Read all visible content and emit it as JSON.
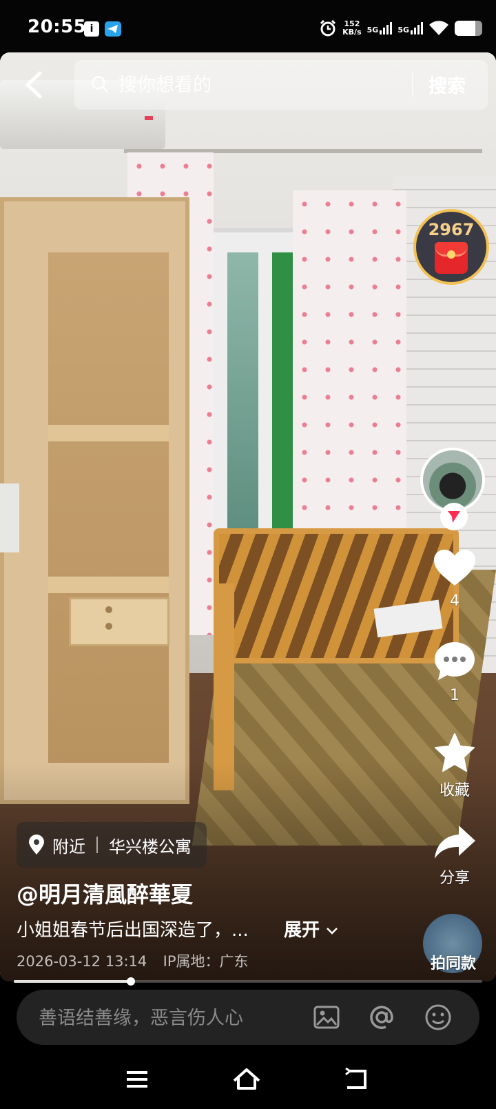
{
  "status_bar": {
    "time": "20:55",
    "speed_value": "152",
    "speed_unit": "KB/s",
    "sim1": "5G",
    "sim2": "5G",
    "battery_level": 0.75,
    "icons": [
      "app-notification-icon",
      "telegram-icon",
      "alarm-icon",
      "signal-icon",
      "wifi-icon",
      "battery-icon"
    ]
  },
  "search": {
    "placeholder": "搜你想看的",
    "button_label": "搜索"
  },
  "red_packet": {
    "count": "2967"
  },
  "actions": {
    "like_count": "4",
    "comment_count": "1",
    "favorite_label": "收藏",
    "share_label": "分享",
    "same_style_label": "拍同款"
  },
  "location": {
    "prefix": "附近",
    "place": "华兴楼公寓"
  },
  "post": {
    "username": "@明月清風醉華夏",
    "caption": "小姐姐春节后出国深造了，...",
    "expand_label": "展开",
    "datetime": "2026-03-12 13:14",
    "ip_location": "IP属地：广东"
  },
  "progress": {
    "fraction": 0.25
  },
  "comment_bar": {
    "placeholder": "善语结善缘，恶言伤人心"
  },
  "colors": {
    "accent_red": "#fe2c55",
    "packet_gold": "#f1c155"
  }
}
